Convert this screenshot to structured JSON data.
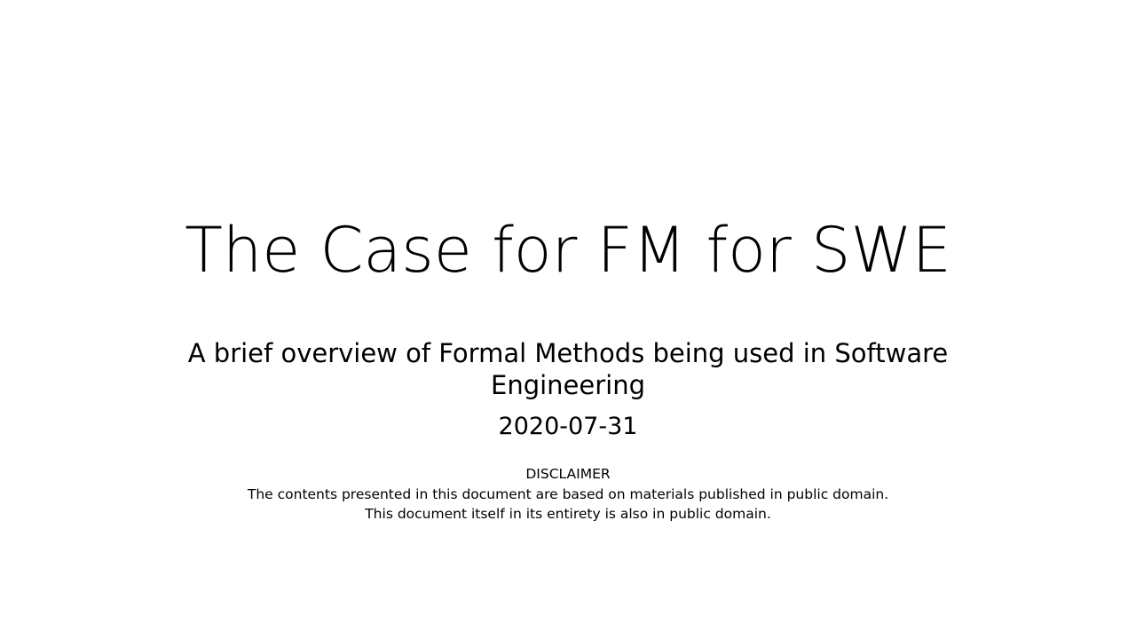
{
  "slide": {
    "title": "The Case for FM for SWE",
    "subtitle_line1": "A brief overview of Formal Methods being used in Software",
    "subtitle_line2": "Engineering",
    "date": "2020-07-31",
    "disclaimer": {
      "heading": "DISCLAIMER",
      "line1": "The contents presented in this document are based on materials published in public domain.",
      "line2": "This document itself in its entirety is also in public domain."
    }
  }
}
